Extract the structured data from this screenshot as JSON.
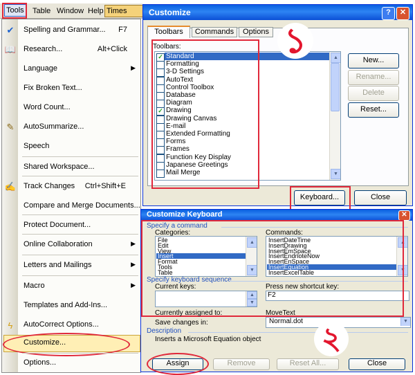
{
  "menubar": {
    "items": [
      "Tools",
      "Table",
      "Window",
      "Help"
    ],
    "font_box": "Times New R"
  },
  "tools_menu": {
    "items": [
      {
        "label": "Spelling and Grammar...",
        "shortcut": "F7",
        "icon": "spelling-check-icon"
      },
      {
        "label": "Research...",
        "shortcut": "Alt+Click",
        "icon": "research-book-icon"
      },
      {
        "label": "Language",
        "submenu": true
      },
      {
        "label": "Fix Broken Text..."
      },
      {
        "label": "Word Count..."
      },
      {
        "label": "AutoSummarize...",
        "icon": "autosummarize-icon"
      },
      {
        "label": "Speech"
      },
      {
        "label": "Shared Workspace..."
      },
      {
        "label": "Track Changes",
        "shortcut": "Ctrl+Shift+E",
        "icon": "track-changes-icon"
      },
      {
        "label": "Compare and Merge Documents..."
      },
      {
        "label": "Protect Document..."
      },
      {
        "label": "Online Collaboration",
        "submenu": true
      },
      {
        "label": "Letters and Mailings",
        "submenu": true
      },
      {
        "label": "Macro",
        "submenu": true
      },
      {
        "label": "Templates and Add-Ins..."
      },
      {
        "label": "AutoCorrect Options...",
        "icon": "autocorrect-lightning-icon"
      },
      {
        "label": "Customize..."
      },
      {
        "label": "Options..."
      }
    ]
  },
  "customize": {
    "title": "Customize",
    "tabs": [
      "Toolbars",
      "Commands",
      "Options"
    ],
    "toolbars_label": "Toolbars:",
    "toolbars": [
      {
        "name": "Standard",
        "checked": true,
        "selected": true
      },
      {
        "name": "Formatting",
        "checked": false
      },
      {
        "name": "3-D Settings",
        "checked": false
      },
      {
        "name": "AutoText",
        "checked": false
      },
      {
        "name": "Control Toolbox",
        "checked": false
      },
      {
        "name": "Database",
        "checked": false
      },
      {
        "name": "Diagram",
        "checked": false
      },
      {
        "name": "Drawing",
        "checked": true
      },
      {
        "name": "Drawing Canvas",
        "checked": false
      },
      {
        "name": "E-mail",
        "checked": false
      },
      {
        "name": "Extended Formatting",
        "checked": false
      },
      {
        "name": "Forms",
        "checked": false
      },
      {
        "name": "Frames",
        "checked": false
      },
      {
        "name": "Function Key Display",
        "checked": false
      },
      {
        "name": "Japanese Greetings",
        "checked": false
      },
      {
        "name": "Mail Merge",
        "checked": false
      }
    ],
    "buttons": {
      "new": "New...",
      "rename": "Rename...",
      "delete": "Delete",
      "reset": "Reset...",
      "keyboard": "Keyboard...",
      "close": "Close"
    },
    "help_glyph": "?",
    "close_glyph": "✕"
  },
  "customize_keyboard": {
    "title": "Customize Keyboard",
    "specify_command": "Specify a command",
    "categories_label": "Categories:",
    "categories": [
      "File",
      "Edit",
      "View",
      "Insert",
      "Format",
      "Tools",
      "Table"
    ],
    "selected_category": "Insert",
    "commands_label": "Commands:",
    "commands": [
      "InsertDateTime",
      "InsertDrawing",
      "InsertEmSpace",
      "InsertEndnoteNow",
      "InsertEnSpace",
      "InsertEquation",
      "InsertExcelTable"
    ],
    "selected_command": "InsertEquation",
    "specify_sequence": "Specify keyboard sequence",
    "current_keys_label": "Current keys:",
    "press_new_label": "Press new shortcut key:",
    "new_shortcut_value": "F2",
    "currently_assigned_label": "Currently assigned to:",
    "currently_assigned_value": "MoveText",
    "save_changes_label": "Save changes in:",
    "save_changes_value": "Normal.dot",
    "description_label": "Description",
    "description_text": "Inserts a Microsoft Equation object",
    "buttons": {
      "assign": "Assign",
      "remove": "Remove",
      "reset_all": "Reset All...",
      "close": "Close"
    },
    "close_glyph": "✕"
  },
  "annotations": {
    "step1": "১",
    "step2": "২"
  },
  "colors": {
    "title_blue": "#0a5fe0",
    "highlight_red": "#e0283a",
    "selection_blue": "#316ac5",
    "dialog_bg": "#ece9d8"
  }
}
